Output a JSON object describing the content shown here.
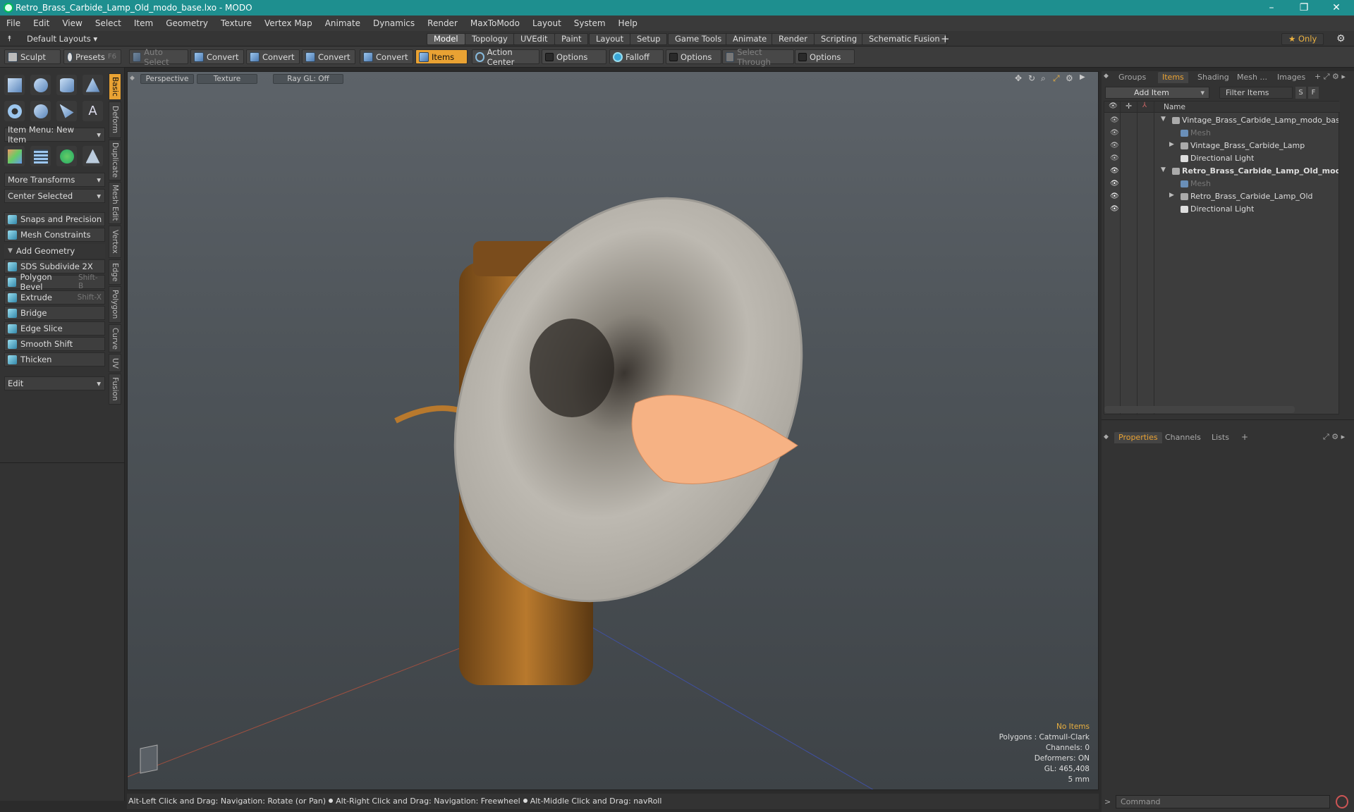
{
  "window": {
    "title": "Retro_Brass_Carbide_Lamp_Old_modo_base.lxo - MODO",
    "min": "–",
    "max": "❐",
    "close": "✕"
  },
  "menu": [
    "File",
    "Edit",
    "View",
    "Select",
    "Item",
    "Geometry",
    "Texture",
    "Vertex Map",
    "Animate",
    "Dynamics",
    "Render",
    "MaxToModo",
    "Layout",
    "System",
    "Help"
  ],
  "layoutbar": {
    "layouts_label": "Default Layouts ▾",
    "tabs": [
      "Model",
      "Topology",
      "UVEdit",
      "Paint",
      "Layout",
      "Setup",
      "Game Tools",
      "Animate",
      "Render",
      "Scripting",
      "Schematic Fusion"
    ],
    "active_tab": "Model",
    "add": "+",
    "only_label": "★  Only"
  },
  "toolbar": {
    "sculpt": "Sculpt",
    "presets": "Presets",
    "presets_shortcut": "F6",
    "auto_select": "Auto Select",
    "convert1": "Convert",
    "convert2": "Convert",
    "convert3": "Convert",
    "convert4": "Convert",
    "items": "Items",
    "action_center": "Action Center",
    "options1": "Options",
    "falloff": "Falloff",
    "options2": "Options",
    "select_through": "Select Through",
    "options3": "Options"
  },
  "leftpanel": {
    "item_menu": "Item Menu: New Item",
    "more_transforms": "More Transforms",
    "center_selected": "Center Selected",
    "snaps": "Snaps and Precision",
    "mesh_constraints": "Mesh Constraints",
    "add_geometry": "Add Geometry",
    "tools": [
      {
        "label": "SDS Subdivide 2X",
        "shortcut": ""
      },
      {
        "label": "Polygon Bevel",
        "shortcut": "Shift-B"
      },
      {
        "label": "Extrude",
        "shortcut": "Shift-X"
      },
      {
        "label": "Bridge",
        "shortcut": ""
      },
      {
        "label": "Edge Slice",
        "shortcut": ""
      },
      {
        "label": "Smooth Shift",
        "shortcut": ""
      },
      {
        "label": "Thicken",
        "shortcut": ""
      }
    ],
    "edit": "Edit",
    "vtabs": [
      "Basic",
      "Deform",
      "Duplicate",
      "Mesh Edit",
      "Vertex",
      "Edge",
      "Polygon",
      "Curve",
      "UV",
      "Fusion"
    ]
  },
  "viewport": {
    "view": "Perspective",
    "shading": "Texture",
    "raygl": "Ray GL: Off",
    "info": {
      "no_items": "No Items",
      "polygons": "Polygons : Catmull-Clark",
      "channels": "Channels: 0",
      "deformers": "Deformers: ON",
      "gl": "GL: 465,408",
      "scale": "5 mm"
    }
  },
  "status": {
    "hint1": "Alt-Left Click and Drag: Navigation: Rotate (or Pan)",
    "hint2": "Alt-Right Click and Drag: Navigation: Freewheel",
    "hint3": "Alt-Middle Click and Drag: navRoll"
  },
  "rightpanel": {
    "tabs": [
      "Groups",
      "Items",
      "Shading",
      "Mesh ...",
      "Images"
    ],
    "active_tab": "Items",
    "add_item": "Add Item",
    "filter_items": "Filter Items",
    "s": "S",
    "f": "F",
    "col_name": "Name",
    "tree": [
      {
        "label": "Vintage_Brass_Carbide_Lamp_modo_base.lxo",
        "indent": 0,
        "arrow": "▼",
        "style": "normal"
      },
      {
        "label": "Mesh",
        "indent": 1,
        "arrow": "",
        "style": "dim"
      },
      {
        "label": "Vintage_Brass_Carbide_Lamp",
        "indent": 1,
        "arrow": "▶",
        "style": "normal"
      },
      {
        "label": "Directional Light",
        "indent": 1,
        "arrow": "",
        "style": "normal"
      },
      {
        "label": "Retro_Brass_Carbide_Lamp_Old_modo_base.lxo",
        "indent": 0,
        "arrow": "▼",
        "style": "bold"
      },
      {
        "label": "Mesh",
        "indent": 1,
        "arrow": "",
        "style": "dim"
      },
      {
        "label": "Retro_Brass_Carbide_Lamp_Old",
        "indent": 1,
        "arrow": "▶",
        "style": "normal"
      },
      {
        "label": "Directional Light",
        "indent": 1,
        "arrow": "",
        "style": "normal"
      }
    ],
    "bottom_tabs": [
      "Properties",
      "Channels",
      "Lists"
    ],
    "bottom_active": "Properties",
    "command_placeholder": "Command"
  }
}
